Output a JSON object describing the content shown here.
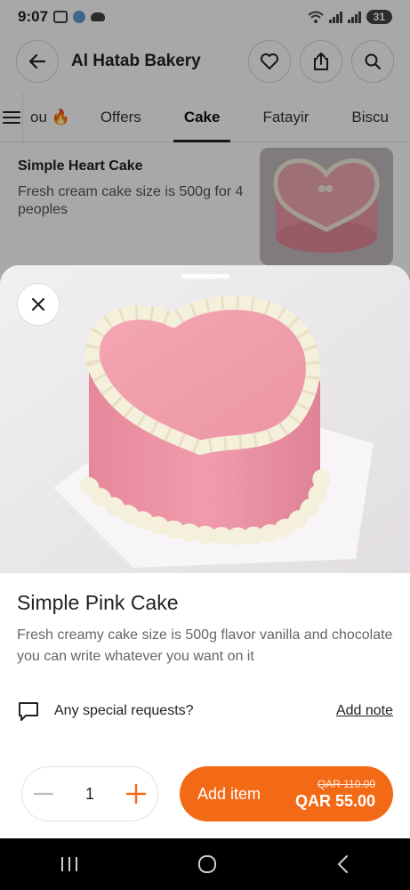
{
  "status_bar": {
    "time": "9:07",
    "battery": "31"
  },
  "header": {
    "title": "Al Hatab Bakery",
    "back_icon": "arrow-left-icon",
    "favorite_icon": "heart-icon",
    "share_icon": "share-icon",
    "search_icon": "search-icon"
  },
  "tabs": [
    {
      "label": "ou 🔥",
      "active": false
    },
    {
      "label": "Offers",
      "active": false
    },
    {
      "label": "Cake",
      "active": true
    },
    {
      "label": "Fatayir",
      "active": false
    },
    {
      "label": "Biscu",
      "active": false
    }
  ],
  "list_item": {
    "title": "Simple Heart Cake",
    "description": "Fresh cream cake size is 500g for 4 peoples"
  },
  "product": {
    "title": "Simple Pink Cake",
    "description": "Fresh creamy cake size is 500g flavor vanilla and chocolate you can write whatever you want on it",
    "requests_label": "Any special requests?",
    "add_note_label": "Add note"
  },
  "cart": {
    "quantity": "1",
    "add_label": "Add item",
    "old_price": "QAR 110.00",
    "new_price": "QAR 55.00"
  },
  "colors": {
    "accent": "#f36a16",
    "cake_pink": "#ee9aa8",
    "frosting": "#f5f0dc"
  }
}
